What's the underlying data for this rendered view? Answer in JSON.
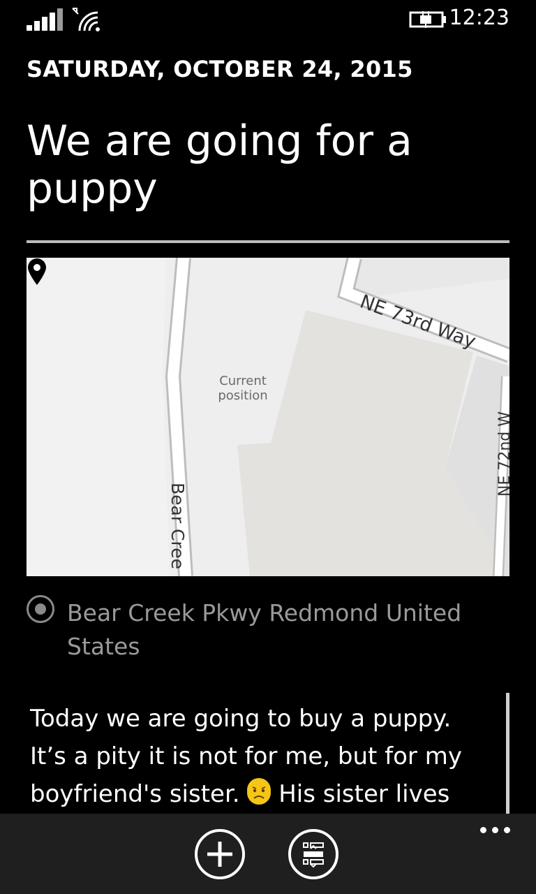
{
  "status_bar": {
    "time": "12:23"
  },
  "entry": {
    "date": "SATURDAY, OCTOBER 24, 2015",
    "title": "We are going for a puppy"
  },
  "map": {
    "pin_label": "Current position",
    "streets": [
      "NE 73rd Way",
      "Bear Cree",
      "NE 72nd W"
    ]
  },
  "location": {
    "text": "Bear Creek Pkwy Redmond United States"
  },
  "note": {
    "line1": "Today we are going to buy a puppy.",
    "line2": "It’s a pity it is not for me, but for my",
    "line3_pre": "boyfriend's sister.",
    "line3_post": "His sister lives",
    "emoji": "confused-face-emoji"
  },
  "app_bar": {
    "buttons": [
      "add-icon",
      "format-icon"
    ],
    "more": "more-options-icon"
  }
}
